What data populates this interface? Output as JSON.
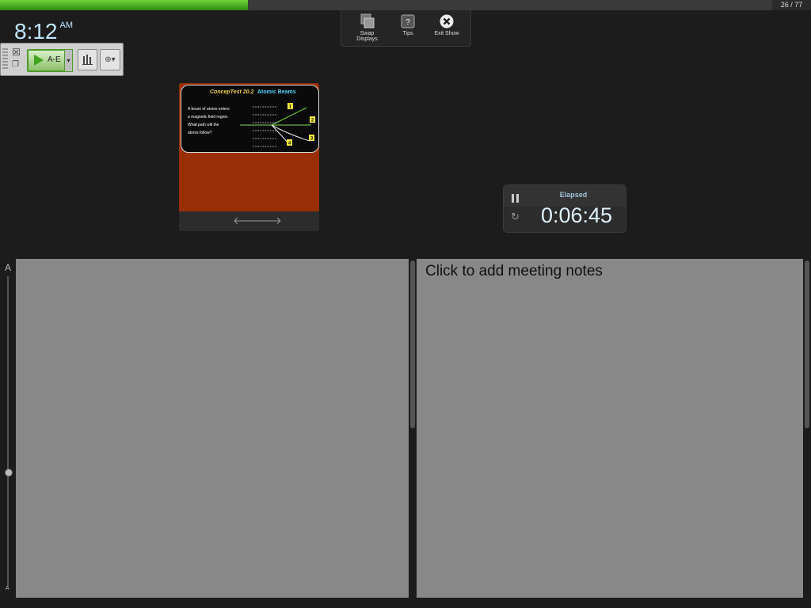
{
  "progress": {
    "fraction": 0.321
  },
  "slide_counter": "26 / 77",
  "clock": {
    "time": "8:12",
    "ampm": "AM"
  },
  "toolbar": {
    "swap_label": "Swap Displays",
    "tips_label": "Tips",
    "exit_label": "Exit Show"
  },
  "tool_palette": {
    "play_label": "A-E",
    "close_glyph": "☒",
    "copy_glyph": "❐",
    "dropdown_glyph": "▾",
    "globe_glyph": "⊕▾",
    "icons": [
      "grip-icon",
      "close-icon",
      "copy-icon",
      "play-icon",
      "chevron-down-icon",
      "bar-chart-icon",
      "globe-icon"
    ]
  },
  "slide": {
    "title_part1": "ConcepTest 20.2",
    "title_part2": "Atomic Beams",
    "question_lines": [
      "A beam of atoms enters",
      "a magnetic field region.",
      "What path will the",
      "atoms follow?"
    ],
    "path_labels": [
      "1",
      "2",
      "3",
      "4"
    ],
    "prev_glyph": "🡐",
    "next_glyph": "🡒"
  },
  "timer": {
    "label": "Elapsed",
    "value": "0:06:45",
    "reset_glyph": "↻"
  },
  "font_slider": {
    "large_label": "A",
    "small_label": "A",
    "level": 0.63
  },
  "meeting_notes": {
    "placeholder": "Click to add meeting notes"
  },
  "colors": {
    "progress_green": "#4fb82a",
    "background": "#1c1c1c",
    "notes_panel": "#888888",
    "slide_bg": "#9a2e06",
    "clock_text": "#bfe6ff"
  }
}
